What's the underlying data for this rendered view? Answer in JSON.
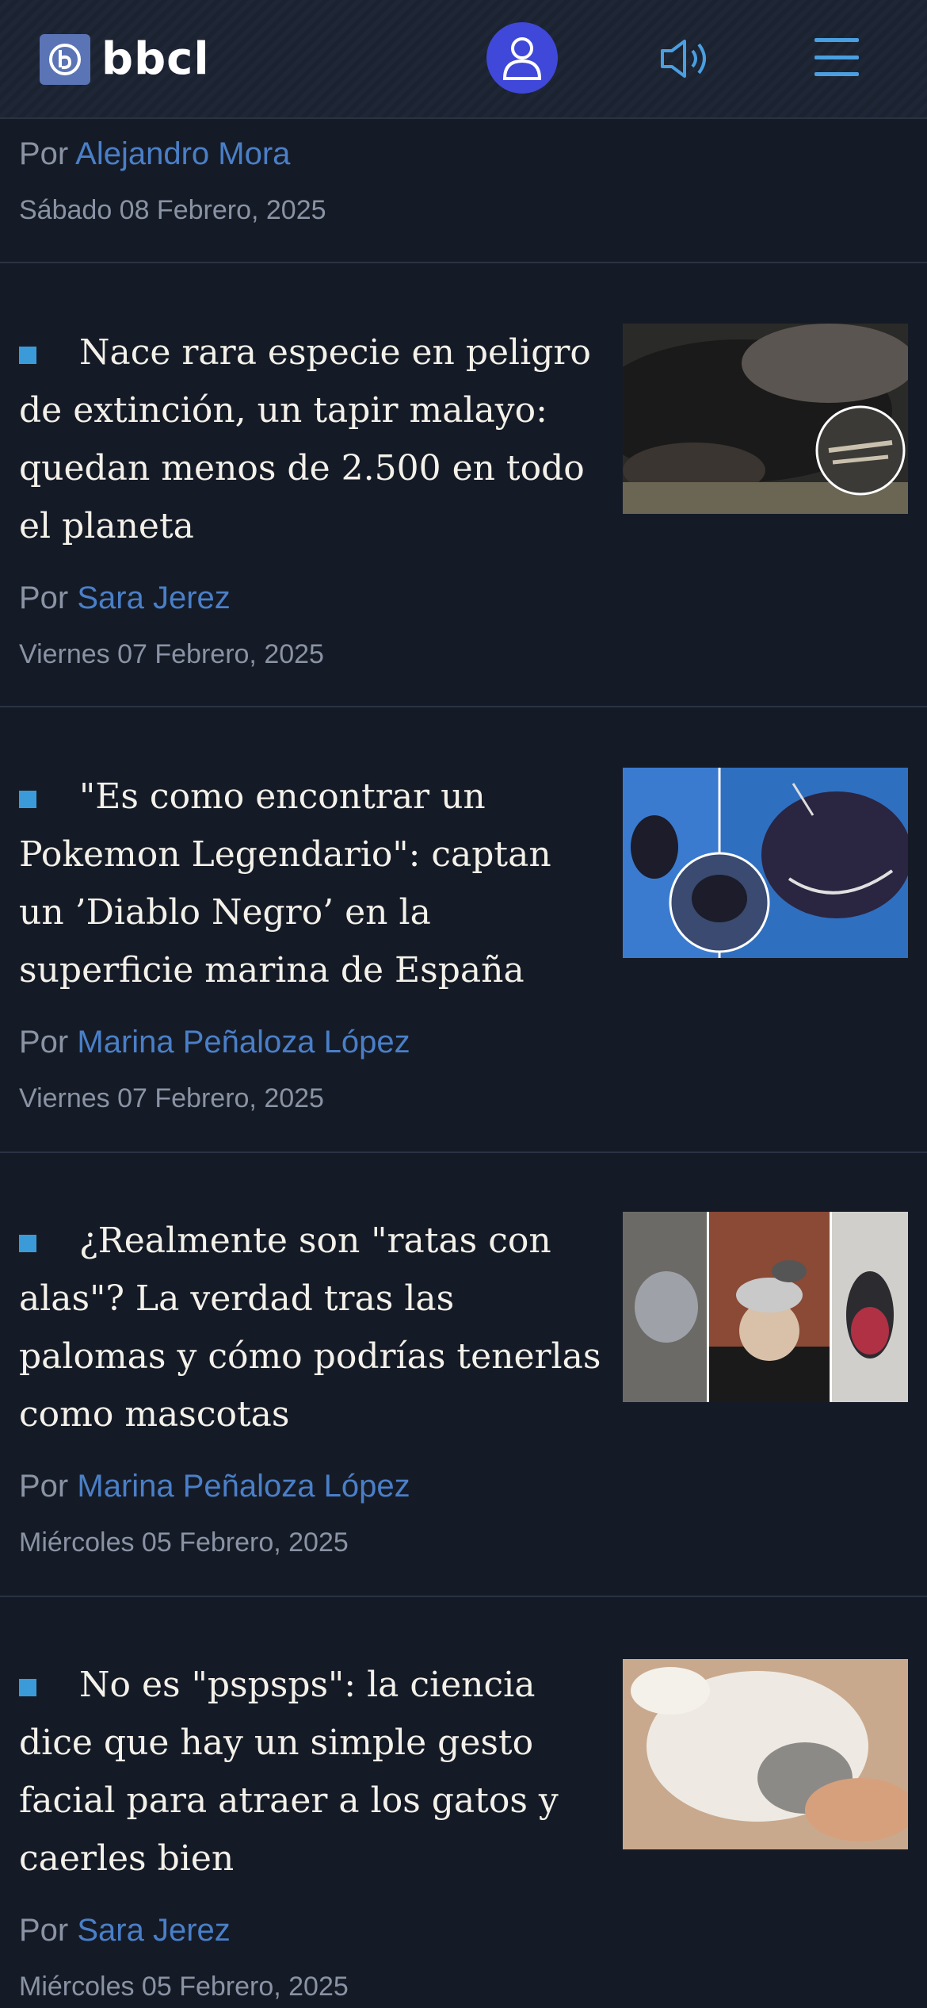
{
  "header": {
    "logo_text": "bbcl",
    "logo_badge_symbol": "b"
  },
  "top_item": {
    "by": "Por",
    "author": "Alejandro Mora",
    "date": "Sábado 08 Febrero, 2025"
  },
  "articles": [
    {
      "headline": "Nace rara especie en peligro de extinción, un tapir malayo: quedan menos de 2.500 en todo el planeta",
      "by": "Por",
      "author": "Sara Jerez",
      "date": "Viernes 07 Febrero, 2025"
    },
    {
      "headline": "\"Es como encontrar un Pokemon Legendario\": captan un ’Diablo Negro’ en la superficie marina de España",
      "by": "Por",
      "author": "Marina Peñaloza López",
      "date": "Viernes 07 Febrero, 2025"
    },
    {
      "headline": "¿Realmente son \"ratas con alas\"? La verdad tras las palomas y cómo podrías tenerlas como mascotas",
      "by": "Por",
      "author": "Marina Peñaloza López",
      "date": "Miércoles 05 Febrero, 2025"
    },
    {
      "headline": "No es \"pspsps\": la ciencia dice que hay un simple gesto facial para atraer a los gatos y caerles bien",
      "by": "Por",
      "author": "Sara Jerez",
      "date": "Miércoles 05 Febrero, 2025"
    }
  ],
  "colors": {
    "background": "#151b26",
    "accent": "#3b9bd8",
    "author_link": "#4a7fc8",
    "avatar_bg": "#3f48d9"
  }
}
